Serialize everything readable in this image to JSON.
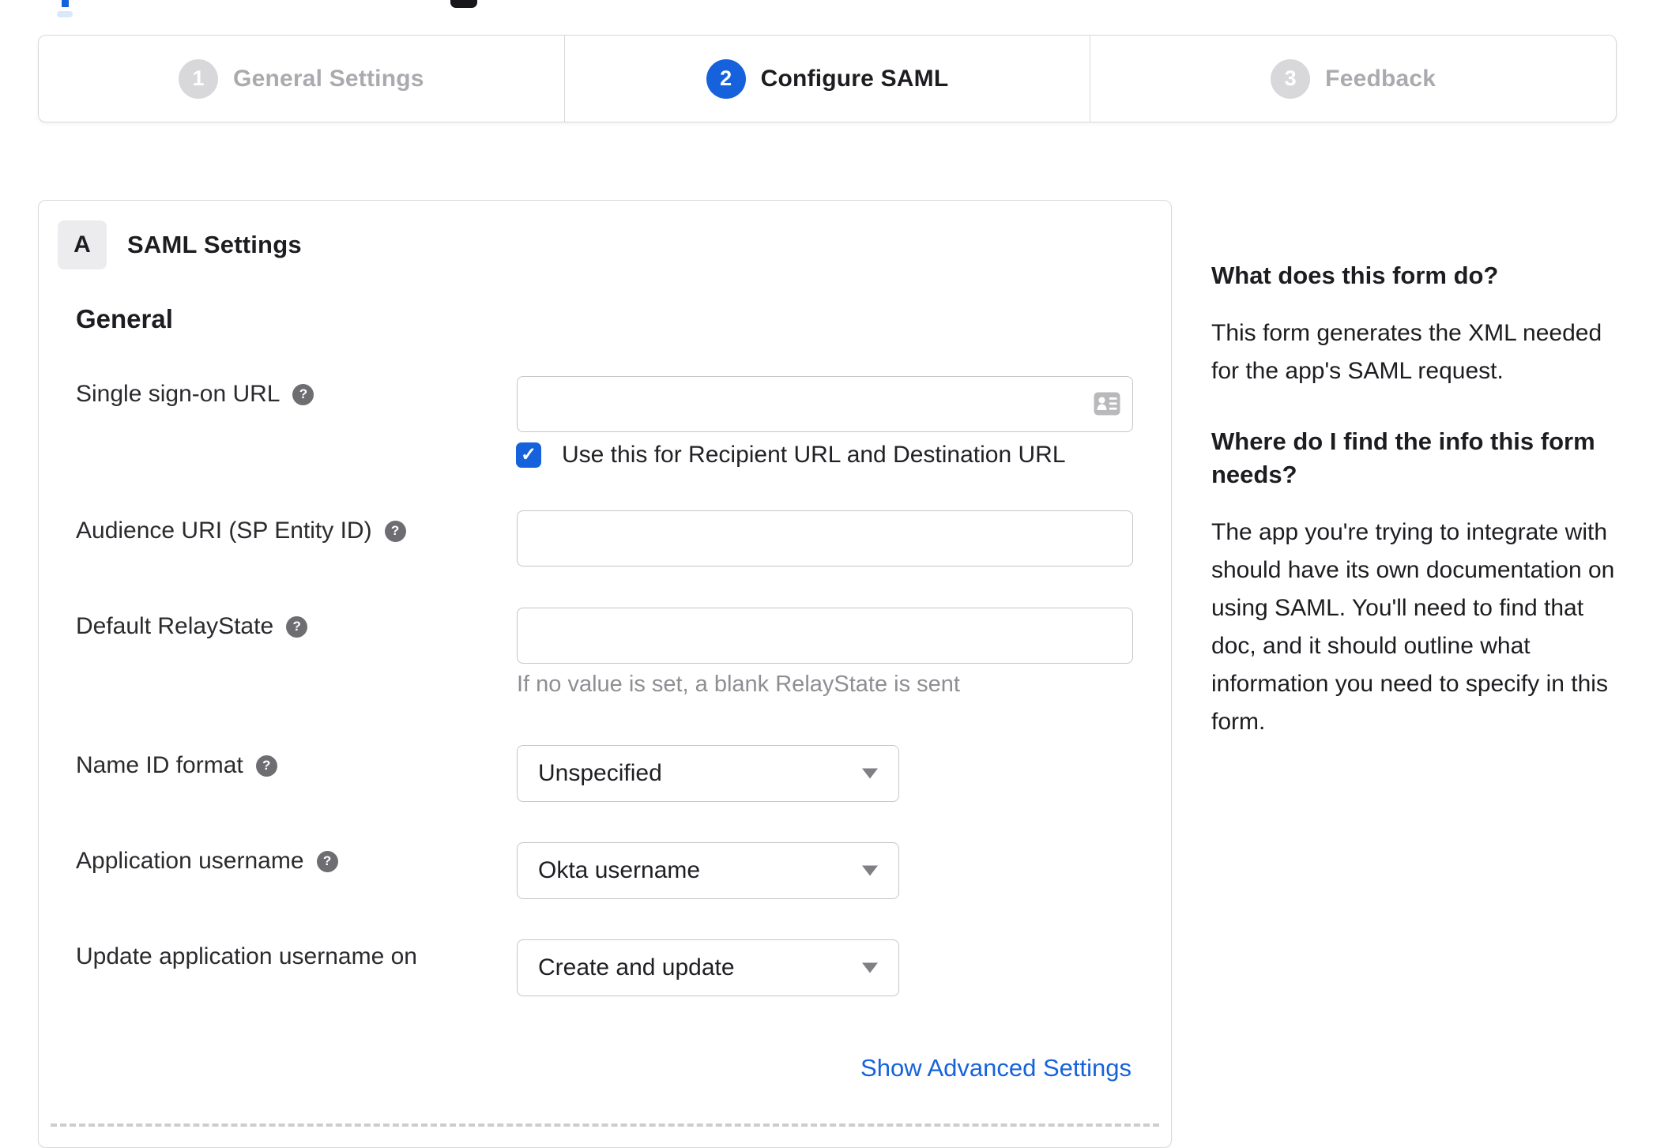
{
  "fragments": {
    "note": "cut-off page header elements at top edge"
  },
  "stepper": {
    "steps": [
      {
        "number": "1",
        "label": "General Settings",
        "state": "inactive"
      },
      {
        "number": "2",
        "label": "Configure SAML",
        "state": "active"
      },
      {
        "number": "3",
        "label": "Feedback",
        "state": "inactive"
      }
    ]
  },
  "panel": {
    "section_letter": "A",
    "section_title": "SAML Settings",
    "group_heading": "General",
    "fields": {
      "sso_url": {
        "label": "Single sign-on URL",
        "value": "",
        "checkbox_label": "Use this for Recipient URL and Destination URL",
        "checkbox_checked": true,
        "check_glyph": "✓"
      },
      "audience_uri": {
        "label": "Audience URI (SP Entity ID)",
        "value": ""
      },
      "relay_state": {
        "label": "Default RelayState",
        "value": "",
        "hint": "If no value is set, a blank RelayState is sent"
      },
      "name_id_format": {
        "label": "Name ID format",
        "value": "Unspecified"
      },
      "app_username": {
        "label": "Application username",
        "value": "Okta username"
      },
      "update_app_username": {
        "label": "Update application username on",
        "value": "Create and update"
      }
    },
    "help_icon_glyph": "?",
    "advanced_link": "Show Advanced Settings"
  },
  "sidebar": {
    "q1": "What does this form do?",
    "a1": "This form generates the XML needed\nfor the app's SAML request.",
    "q2": "Where do I find the info this form\nneeds?",
    "a2": "The app you're trying to integrate with\nshould have its own documentation on\nusing SAML. You'll need to find that\ndoc, and it should outline what\ninformation you need to specify in this\nform."
  },
  "colors": {
    "accent_blue": "#1662dd",
    "link_blue": "#1662dd",
    "inactive_gray": "#d8d8db",
    "border_gray": "#d9d9d9"
  }
}
